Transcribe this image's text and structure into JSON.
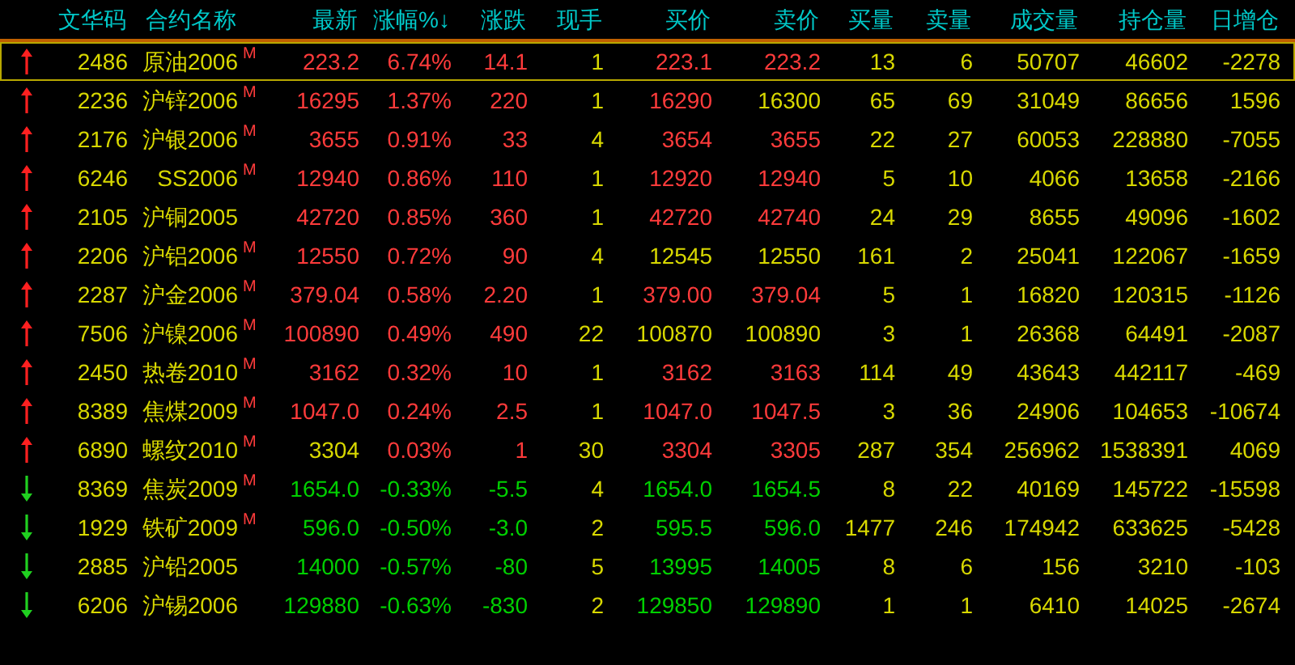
{
  "columns": [
    "文华码",
    "合约名称",
    "最新",
    "涨幅%↓",
    "涨跌",
    "现手",
    "买价",
    "卖价",
    "买量",
    "卖量",
    "成交量",
    "持仓量",
    "日增仓"
  ],
  "rows": [
    {
      "rising": true,
      "selected": true,
      "code": "2486",
      "name": "原油2006",
      "badge": "M",
      "quotes": [
        {
          "text": "223.2",
          "color": "#ff3b3b"
        },
        {
          "text": "6.74%",
          "color": "#ff3b3b"
        },
        {
          "text": "14.1",
          "color": "#ff3b3b"
        }
      ],
      "hand": "1",
      "bids": [
        {
          "text": "223.1",
          "color": "#ff3b3b"
        },
        {
          "text": "223.2",
          "color": "#ff3b3b"
        }
      ],
      "stats": [
        "13",
        "6",
        "50707",
        "46602",
        "-2278"
      ]
    },
    {
      "rising": true,
      "selected": false,
      "code": "2236",
      "name": "沪锌2006",
      "badge": "M",
      "quotes": [
        {
          "text": "16295",
          "color": "#ff3b3b"
        },
        {
          "text": "1.37%",
          "color": "#ff3b3b"
        },
        {
          "text": "220",
          "color": "#ff3b3b"
        }
      ],
      "hand": "1",
      "bids": [
        {
          "text": "16290",
          "color": "#ff3b3b"
        },
        {
          "text": "16300",
          "color": "#d8d800"
        }
      ],
      "stats": [
        "65",
        "69",
        "31049",
        "86656",
        "1596"
      ]
    },
    {
      "rising": true,
      "selected": false,
      "code": "2176",
      "name": "沪银2006",
      "badge": "M",
      "quotes": [
        {
          "text": "3655",
          "color": "#ff3b3b"
        },
        {
          "text": "0.91%",
          "color": "#ff3b3b"
        },
        {
          "text": "33",
          "color": "#ff3b3b"
        }
      ],
      "hand": "4",
      "bids": [
        {
          "text": "3654",
          "color": "#ff3b3b"
        },
        {
          "text": "3655",
          "color": "#ff3b3b"
        }
      ],
      "stats": [
        "22",
        "27",
        "60053",
        "228880",
        "-7055"
      ]
    },
    {
      "rising": true,
      "selected": false,
      "code": "6246",
      "name": "SS2006",
      "badge": "M",
      "quotes": [
        {
          "text": "12940",
          "color": "#ff3b3b"
        },
        {
          "text": "0.86%",
          "color": "#ff3b3b"
        },
        {
          "text": "110",
          "color": "#ff3b3b"
        }
      ],
      "hand": "1",
      "bids": [
        {
          "text": "12920",
          "color": "#ff3b3b"
        },
        {
          "text": "12940",
          "color": "#ff3b3b"
        }
      ],
      "stats": [
        "5",
        "10",
        "4066",
        "13658",
        "-2166"
      ]
    },
    {
      "rising": true,
      "selected": false,
      "code": "2105",
      "name": "沪铜2005",
      "quotes": [
        {
          "text": "42720",
          "color": "#ff3b3b"
        },
        {
          "text": "0.85%",
          "color": "#ff3b3b"
        },
        {
          "text": "360",
          "color": "#ff3b3b"
        }
      ],
      "hand": "1",
      "bids": [
        {
          "text": "42720",
          "color": "#ff3b3b"
        },
        {
          "text": "42740",
          "color": "#ff3b3b"
        }
      ],
      "stats": [
        "24",
        "29",
        "8655",
        "49096",
        "-1602"
      ]
    },
    {
      "rising": true,
      "selected": false,
      "code": "2206",
      "name": "沪铝2006",
      "badge": "M",
      "quotes": [
        {
          "text": "12550",
          "color": "#ff3b3b"
        },
        {
          "text": "0.72%",
          "color": "#ff3b3b"
        },
        {
          "text": "90",
          "color": "#ff3b3b"
        }
      ],
      "hand": "4",
      "bids": [
        {
          "text": "12545",
          "color": "#d8d800"
        },
        {
          "text": "12550",
          "color": "#d8d800"
        }
      ],
      "stats": [
        "161",
        "2",
        "25041",
        "122067",
        "-1659"
      ]
    },
    {
      "rising": true,
      "selected": false,
      "code": "2287",
      "name": "沪金2006",
      "badge": "M",
      "quotes": [
        {
          "text": "379.04",
          "color": "#ff3b3b"
        },
        {
          "text": "0.58%",
          "color": "#ff3b3b"
        },
        {
          "text": "2.20",
          "color": "#ff3b3b"
        }
      ],
      "hand": "1",
      "bids": [
        {
          "text": "379.00",
          "color": "#ff3b3b"
        },
        {
          "text": "379.04",
          "color": "#ff3b3b"
        }
      ],
      "stats": [
        "5",
        "1",
        "16820",
        "120315",
        "-1126"
      ]
    },
    {
      "rising": true,
      "selected": false,
      "code": "7506",
      "name": "沪镍2006",
      "badge": "M",
      "quotes": [
        {
          "text": "100890",
          "color": "#ff3b3b"
        },
        {
          "text": "0.49%",
          "color": "#ff3b3b"
        },
        {
          "text": "490",
          "color": "#ff3b3b"
        }
      ],
      "hand": "22",
      "bids": [
        {
          "text": "100870",
          "color": "#d8d800"
        },
        {
          "text": "100890",
          "color": "#d8d800"
        }
      ],
      "stats": [
        "3",
        "1",
        "26368",
        "64491",
        "-2087"
      ]
    },
    {
      "rising": true,
      "selected": false,
      "code": "2450",
      "name": "热卷2010",
      "badge": "M",
      "quotes": [
        {
          "text": "3162",
          "color": "#ff3b3b"
        },
        {
          "text": "0.32%",
          "color": "#ff3b3b"
        },
        {
          "text": "10",
          "color": "#ff3b3b"
        }
      ],
      "hand": "1",
      "bids": [
        {
          "text": "3162",
          "color": "#ff3b3b"
        },
        {
          "text": "3163",
          "color": "#ff3b3b"
        }
      ],
      "stats": [
        "114",
        "49",
        "43643",
        "442117",
        "-469"
      ]
    },
    {
      "rising": true,
      "selected": false,
      "code": "8389",
      "name": "焦煤2009",
      "badge": "M",
      "quotes": [
        {
          "text": "1047.0",
          "color": "#ff3b3b"
        },
        {
          "text": "0.24%",
          "color": "#ff3b3b"
        },
        {
          "text": "2.5",
          "color": "#ff3b3b"
        }
      ],
      "hand": "1",
      "bids": [
        {
          "text": "1047.0",
          "color": "#ff3b3b"
        },
        {
          "text": "1047.5",
          "color": "#ff3b3b"
        }
      ],
      "stats": [
        "3",
        "36",
        "24906",
        "104653",
        "-10674"
      ]
    },
    {
      "rising": true,
      "selected": false,
      "code": "6890",
      "name": "螺纹2010",
      "badge": "M",
      "quotes": [
        {
          "text": "3304",
          "color": "#d8d800"
        },
        {
          "text": "0.03%",
          "color": "#ff3b3b"
        },
        {
          "text": "1",
          "color": "#ff3b3b"
        }
      ],
      "hand": "30",
      "bids": [
        {
          "text": "3304",
          "color": "#ff3b3b"
        },
        {
          "text": "3305",
          "color": "#ff3b3b"
        }
      ],
      "stats": [
        "287",
        "354",
        "256962",
        "1538391",
        "4069"
      ]
    },
    {
      "rising": false,
      "selected": false,
      "code": "8369",
      "name": "焦炭2009",
      "badge": "M",
      "quotes": [
        {
          "text": "1654.0",
          "color": "#00d000"
        },
        {
          "text": "-0.33%",
          "color": "#00d000"
        },
        {
          "text": "-5.5",
          "color": "#00d000"
        }
      ],
      "hand": "4",
      "bids": [
        {
          "text": "1654.0",
          "color": "#00d000"
        },
        {
          "text": "1654.5",
          "color": "#00d000"
        }
      ],
      "stats": [
        "8",
        "22",
        "40169",
        "145722",
        "-15598"
      ]
    },
    {
      "rising": false,
      "selected": false,
      "code": "1929",
      "name": "铁矿2009",
      "badge": "M",
      "quotes": [
        {
          "text": "596.0",
          "color": "#00d000"
        },
        {
          "text": "-0.50%",
          "color": "#00d000"
        },
        {
          "text": "-3.0",
          "color": "#00d000"
        }
      ],
      "hand": "2",
      "bids": [
        {
          "text": "595.5",
          "color": "#00d000"
        },
        {
          "text": "596.0",
          "color": "#00d000"
        }
      ],
      "stats": [
        "1477",
        "246",
        "174942",
        "633625",
        "-5428"
      ]
    },
    {
      "rising": false,
      "selected": false,
      "code": "2885",
      "name": "沪铅2005",
      "quotes": [
        {
          "text": "14000",
          "color": "#00d000"
        },
        {
          "text": "-0.57%",
          "color": "#00d000"
        },
        {
          "text": "-80",
          "color": "#00d000"
        }
      ],
      "hand": "5",
      "bids": [
        {
          "text": "13995",
          "color": "#00d000"
        },
        {
          "text": "14005",
          "color": "#00d000"
        }
      ],
      "stats": [
        "8",
        "6",
        "156",
        "3210",
        "-103"
      ]
    },
    {
      "rising": false,
      "selected": false,
      "code": "6206",
      "name": "沪锡2006",
      "quotes": [
        {
          "text": "129880",
          "color": "#00d000"
        },
        {
          "text": "-0.63%",
          "color": "#00d000"
        },
        {
          "text": "-830",
          "color": "#00d000"
        }
      ],
      "hand": "2",
      "bids": [
        {
          "text": "129850",
          "color": "#00d000"
        },
        {
          "text": "129890",
          "color": "#00d000"
        }
      ],
      "stats": [
        "1",
        "1",
        "6410",
        "14025",
        "-2674"
      ]
    }
  ]
}
